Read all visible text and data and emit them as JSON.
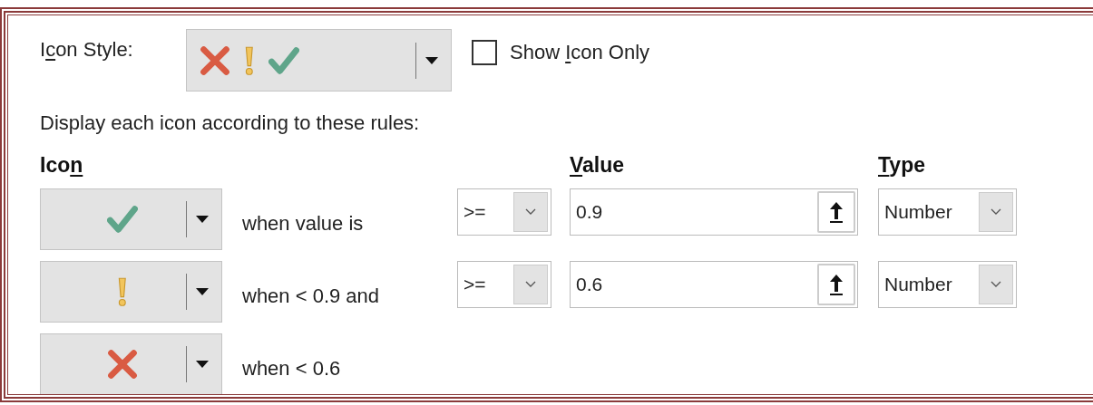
{
  "icon_style": {
    "label": {
      "before": "I",
      "key": "c",
      "after": "on Style:"
    },
    "icons": [
      {
        "kind": "cross"
      },
      {
        "kind": "exclamation"
      },
      {
        "kind": "check"
      }
    ]
  },
  "show_icon_only": {
    "label": {
      "before": "Show ",
      "key": "I",
      "after": "con Only"
    },
    "checked": false
  },
  "instruction": "Display each icon according to these rules:",
  "headers": {
    "icon": {
      "before": "Ico",
      "key": "n"
    },
    "value": {
      "key": "V",
      "after": "alue"
    },
    "type": {
      "key": "T",
      "after": "ype"
    }
  },
  "rules": [
    {
      "kind": "check",
      "condition": "when value is",
      "operator": ">=",
      "value": "0.9",
      "type": "Number"
    },
    {
      "kind": "exclamation",
      "condition": "when < 0.9 and",
      "operator": ">=",
      "value": "0.6",
      "type": "Number"
    },
    {
      "kind": "cross",
      "condition": "when < 0.6"
    }
  ]
}
